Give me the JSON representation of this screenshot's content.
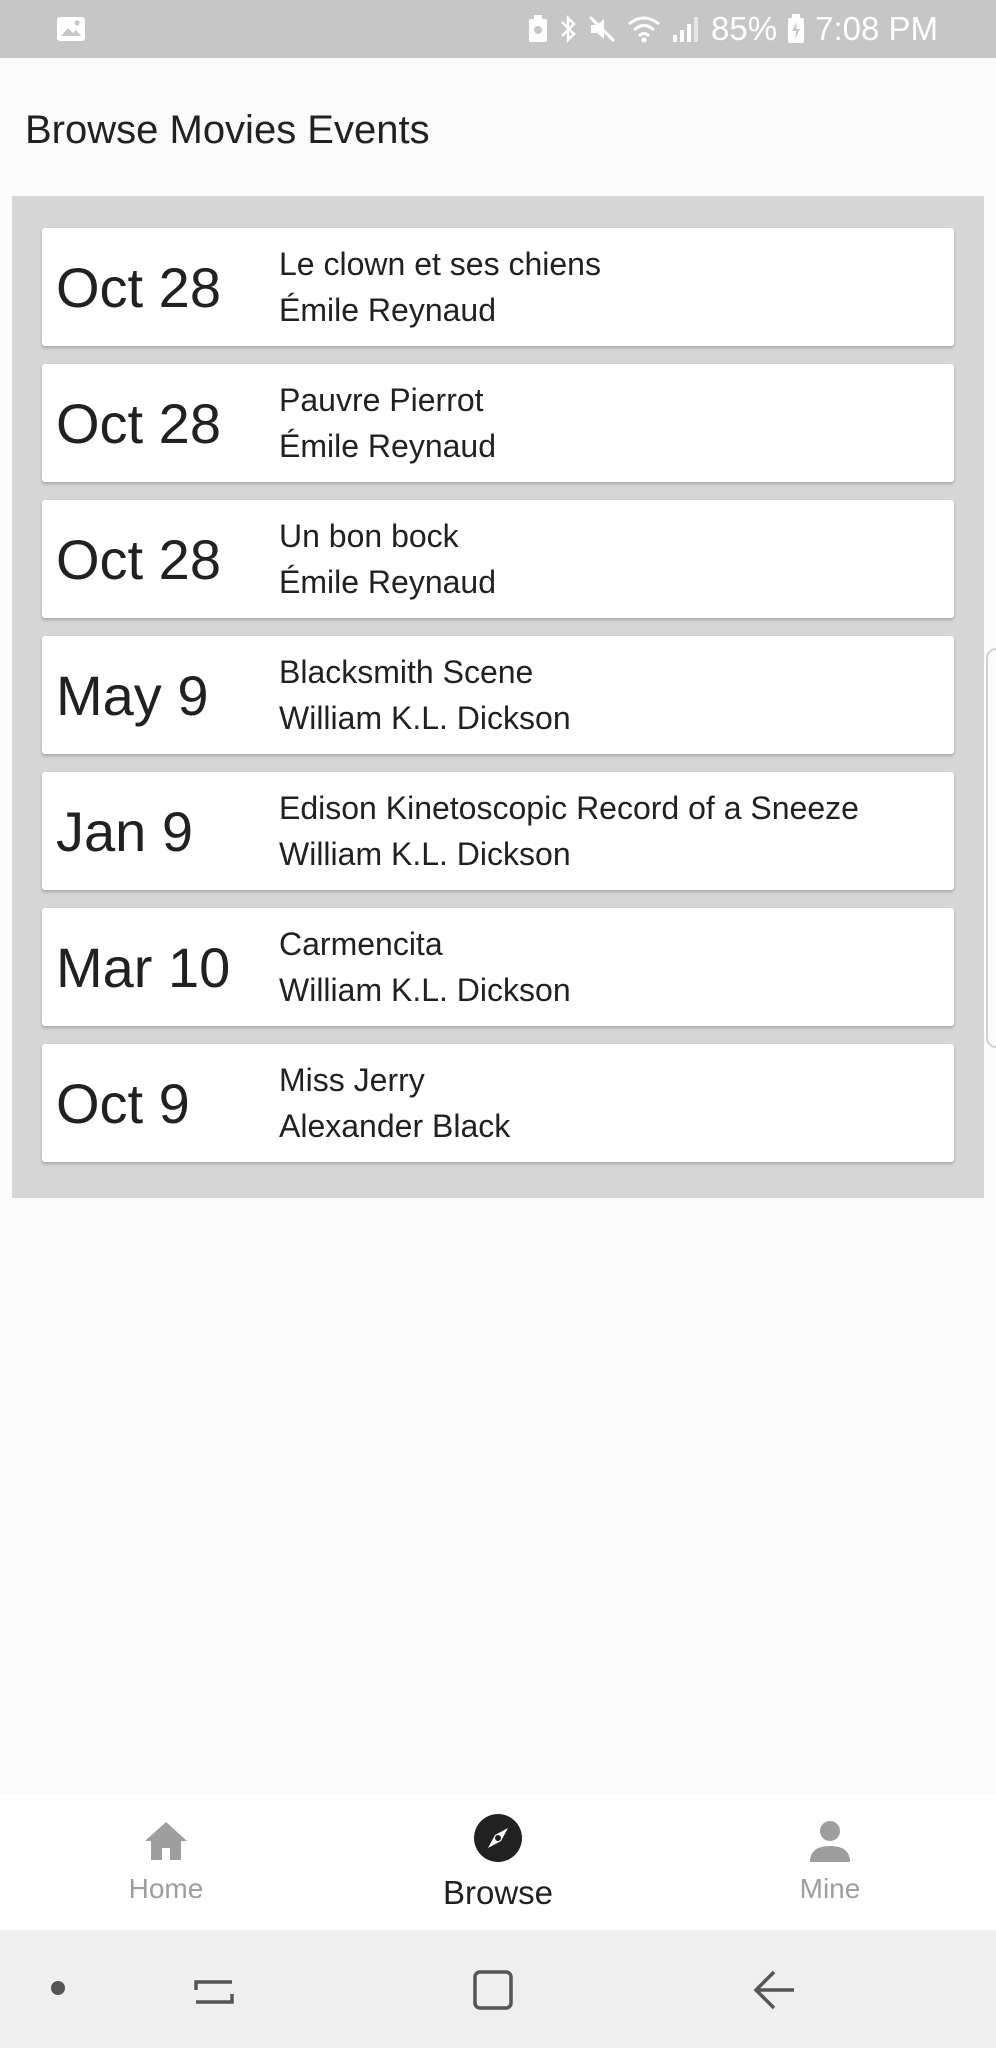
{
  "status_bar": {
    "battery_percent": "85%",
    "time": "7:08 PM"
  },
  "page": {
    "title": "Browse Movies Events"
  },
  "events": [
    {
      "date": "Oct 28",
      "title": "Le clown et ses chiens",
      "author": "Émile Reynaud"
    },
    {
      "date": "Oct 28",
      "title": "Pauvre Pierrot",
      "author": "Émile Reynaud"
    },
    {
      "date": "Oct 28",
      "title": "Un bon bock",
      "author": "Émile Reynaud"
    },
    {
      "date": "May 9",
      "title": "Blacksmith Scene",
      "author": "William K.L. Dickson"
    },
    {
      "date": "Jan 9",
      "title": "Edison Kinetoscopic Record of a Sneeze",
      "author": "William K.L. Dickson"
    },
    {
      "date": "Mar 10",
      "title": "Carmencita",
      "author": "William K.L. Dickson"
    },
    {
      "date": "Oct 9",
      "title": "Miss Jerry",
      "author": "Alexander Black"
    }
  ],
  "bottom_nav": {
    "items": [
      {
        "label": "Home",
        "icon": "home-icon",
        "active": false
      },
      {
        "label": "Browse",
        "icon": "compass-icon",
        "active": true
      },
      {
        "label": "Mine",
        "icon": "person-icon",
        "active": false
      }
    ]
  },
  "colors": {
    "status_bar_bg": "#c6c6c6",
    "list_bg": "#d6d6d6",
    "card_bg": "#ffffff",
    "active_nav": "#212121",
    "inactive_nav": "#9e9e9e"
  }
}
